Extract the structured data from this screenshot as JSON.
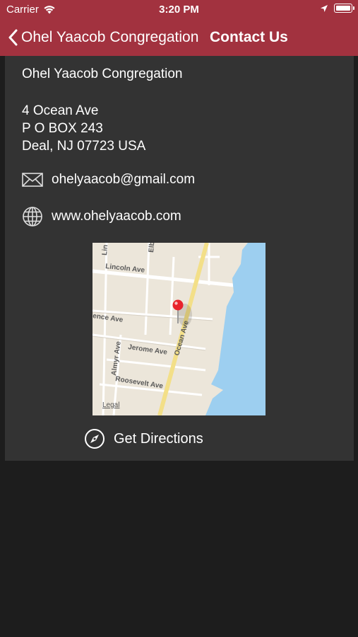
{
  "status_bar": {
    "carrier": "Carrier",
    "time": "3:20 PM"
  },
  "nav": {
    "back_label": "Ohel Yaacob Congregation",
    "title": "Contact Us"
  },
  "contact": {
    "name": "Ohel Yaacob Congregation",
    "address_lines": [
      "4 Ocean Ave",
      "P O BOX 243",
      "Deal, NJ 07723 USA"
    ],
    "email": "ohelyaacob@gmail.com",
    "website": "www.ohelyaacob.com"
  },
  "map": {
    "streets": [
      "Lincoln Ave",
      "Lin",
      "Elb",
      "ence Ave",
      "Ocean Ave",
      "Jerome Ave",
      "Almyr Ave",
      "Roosevelt Ave"
    ],
    "legal_label": "Legal"
  },
  "directions": {
    "label": "Get Directions"
  },
  "colors": {
    "nav_bar": "#a2323f",
    "card_background": "#333333",
    "page_background": "#1d1d1d",
    "map_water": "#9dcff0",
    "map_land": "#ece6da",
    "pin": "#e8232c"
  }
}
